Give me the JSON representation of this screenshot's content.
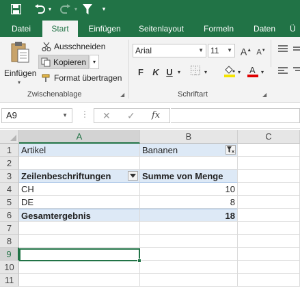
{
  "colors": {
    "accent": "#217346",
    "pivot_header": "#dde9f6",
    "font_color_bar": "#e00000",
    "fill_color_bar": "#f5e400"
  },
  "qat": {
    "icons": [
      "save-icon",
      "undo-icon",
      "redo-icon",
      "filter-icon"
    ]
  },
  "tabs": [
    {
      "label": "Datei"
    },
    {
      "label": "Start",
      "active": true
    },
    {
      "label": "Einfügen"
    },
    {
      "label": "Seitenlayout"
    },
    {
      "label": "Formeln"
    },
    {
      "label": "Daten"
    },
    {
      "label": "Ü"
    }
  ],
  "ribbon": {
    "clipboard": {
      "paste_label": "Einfügen",
      "cut_label": "Ausschneiden",
      "copy_label": "Kopieren",
      "format_painter_label": "Format übertragen",
      "group_label": "Zwischenablage"
    },
    "font": {
      "font_name": "Arial",
      "font_size": "11",
      "bold": "F",
      "italic": "K",
      "underline": "U",
      "group_label": "Schriftart"
    }
  },
  "formula_bar": {
    "name_box": "A9",
    "cancel": "✕",
    "confirm": "✓",
    "fx": "fx",
    "value": ""
  },
  "grid": {
    "columns": [
      "A",
      "B",
      "C"
    ],
    "selected_column": "A",
    "rows": [
      "1",
      "2",
      "3",
      "4",
      "5",
      "6",
      "7",
      "8",
      "9",
      "10",
      "11"
    ],
    "selected_row": "9",
    "cells": {
      "A1": "Artikel",
      "B1": "Bananen",
      "A3": "Zeilenbeschriftungen",
      "B3": "Summe von Menge",
      "A4": "CH",
      "B4": "10",
      "A5": "DE",
      "B5": "8",
      "A6": "Gesamtergebnis",
      "B6": "18"
    },
    "active_cell": "A9"
  }
}
